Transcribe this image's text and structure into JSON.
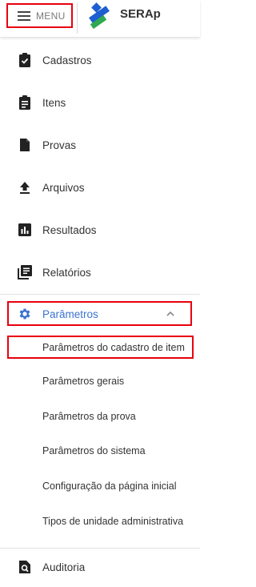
{
  "header": {
    "menu_label": "MENU",
    "app_title": "SERAp"
  },
  "nav": {
    "items": [
      {
        "label": "Cadastros",
        "icon": "clipboard-check-icon"
      },
      {
        "label": "Itens",
        "icon": "clipboard-list-icon"
      },
      {
        "label": "Provas",
        "icon": "document-icon"
      },
      {
        "label": "Arquivos",
        "icon": "upload-icon"
      },
      {
        "label": "Resultados",
        "icon": "bar-chart-icon"
      },
      {
        "label": "Relatórios",
        "icon": "report-stack-icon"
      }
    ],
    "parametros": {
      "label": "Parâmetros",
      "icon": "gear-icon",
      "expanded": true,
      "subitems": [
        "Parâmetros do cadastro de item",
        "Parâmetros gerais",
        "Parâmetros da prova",
        "Parâmetros do sistema",
        "Configuração da página inicial",
        "Tipos de unidade administrativa"
      ]
    },
    "auditoria": {
      "label": "Auditoria",
      "icon": "audit-search-icon"
    }
  },
  "colors": {
    "accent": "#3b73cf",
    "highlight_border": "#e8000f",
    "logo_blue": "#1d5fd0",
    "logo_green": "#2fa84f"
  }
}
